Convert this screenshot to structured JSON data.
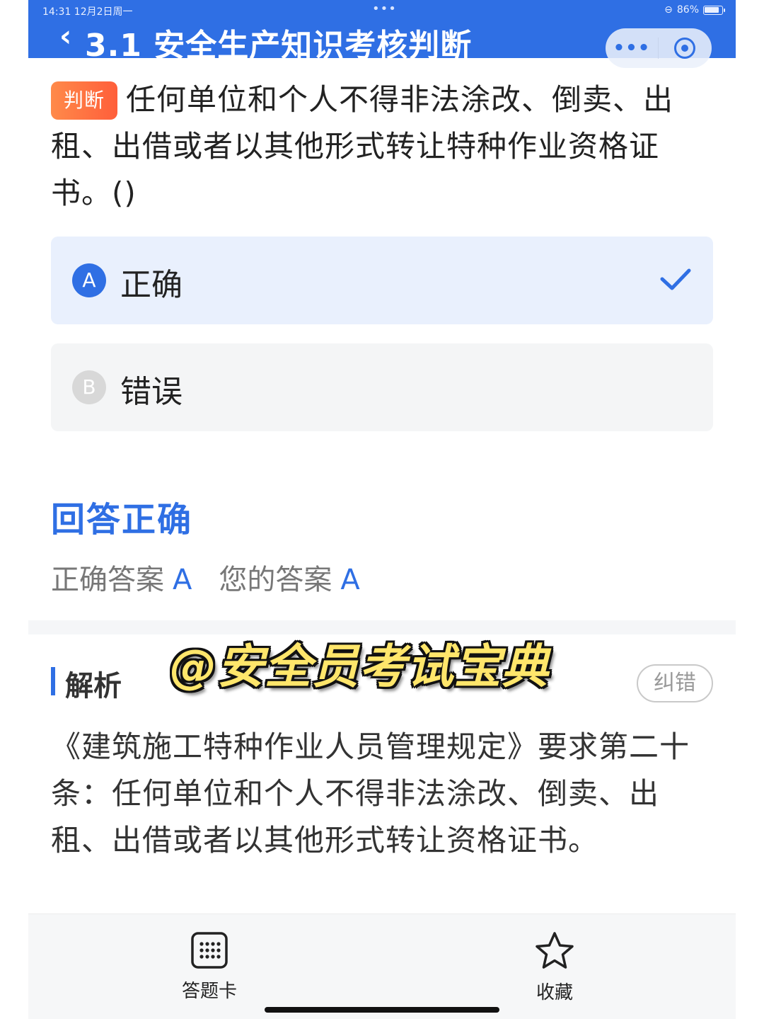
{
  "status_bar": {
    "time_date": "14:31  12月2日周一",
    "dots": "•••",
    "battery": "86%",
    "battery_level": 0.86
  },
  "header": {
    "title": "3.1 安全生产知识考核判断",
    "more_label": "•••"
  },
  "question": {
    "tag": "判断",
    "text": "任何单位和个人不得非法涂改、倒卖、出租、出借或者以其他形式转让特种作业资格证书。()"
  },
  "options": [
    {
      "letter": "A",
      "label": "正确",
      "selected": true
    },
    {
      "letter": "B",
      "label": "错误",
      "selected": false
    }
  ],
  "result": {
    "title": "回答正确",
    "correct_label": "正确答案",
    "correct_value": "A",
    "yours_label": "您的答案",
    "yours_value": "A"
  },
  "analysis": {
    "title": "解析",
    "correction_button": "纠错",
    "text": "《建筑施工特种作业人员管理规定》要求第二十条：任何单位和个人不得非法涂改、倒卖、出租、出借或者以其他形式转让资格证书。"
  },
  "watermark": "@安全员考试宝典",
  "bottom_bar": {
    "answer_card": "答题卡",
    "favorite": "收藏"
  },
  "colors": {
    "primary": "#2f6fe4",
    "tag": "#ff6a3d",
    "watermark": "#ffe66b"
  }
}
